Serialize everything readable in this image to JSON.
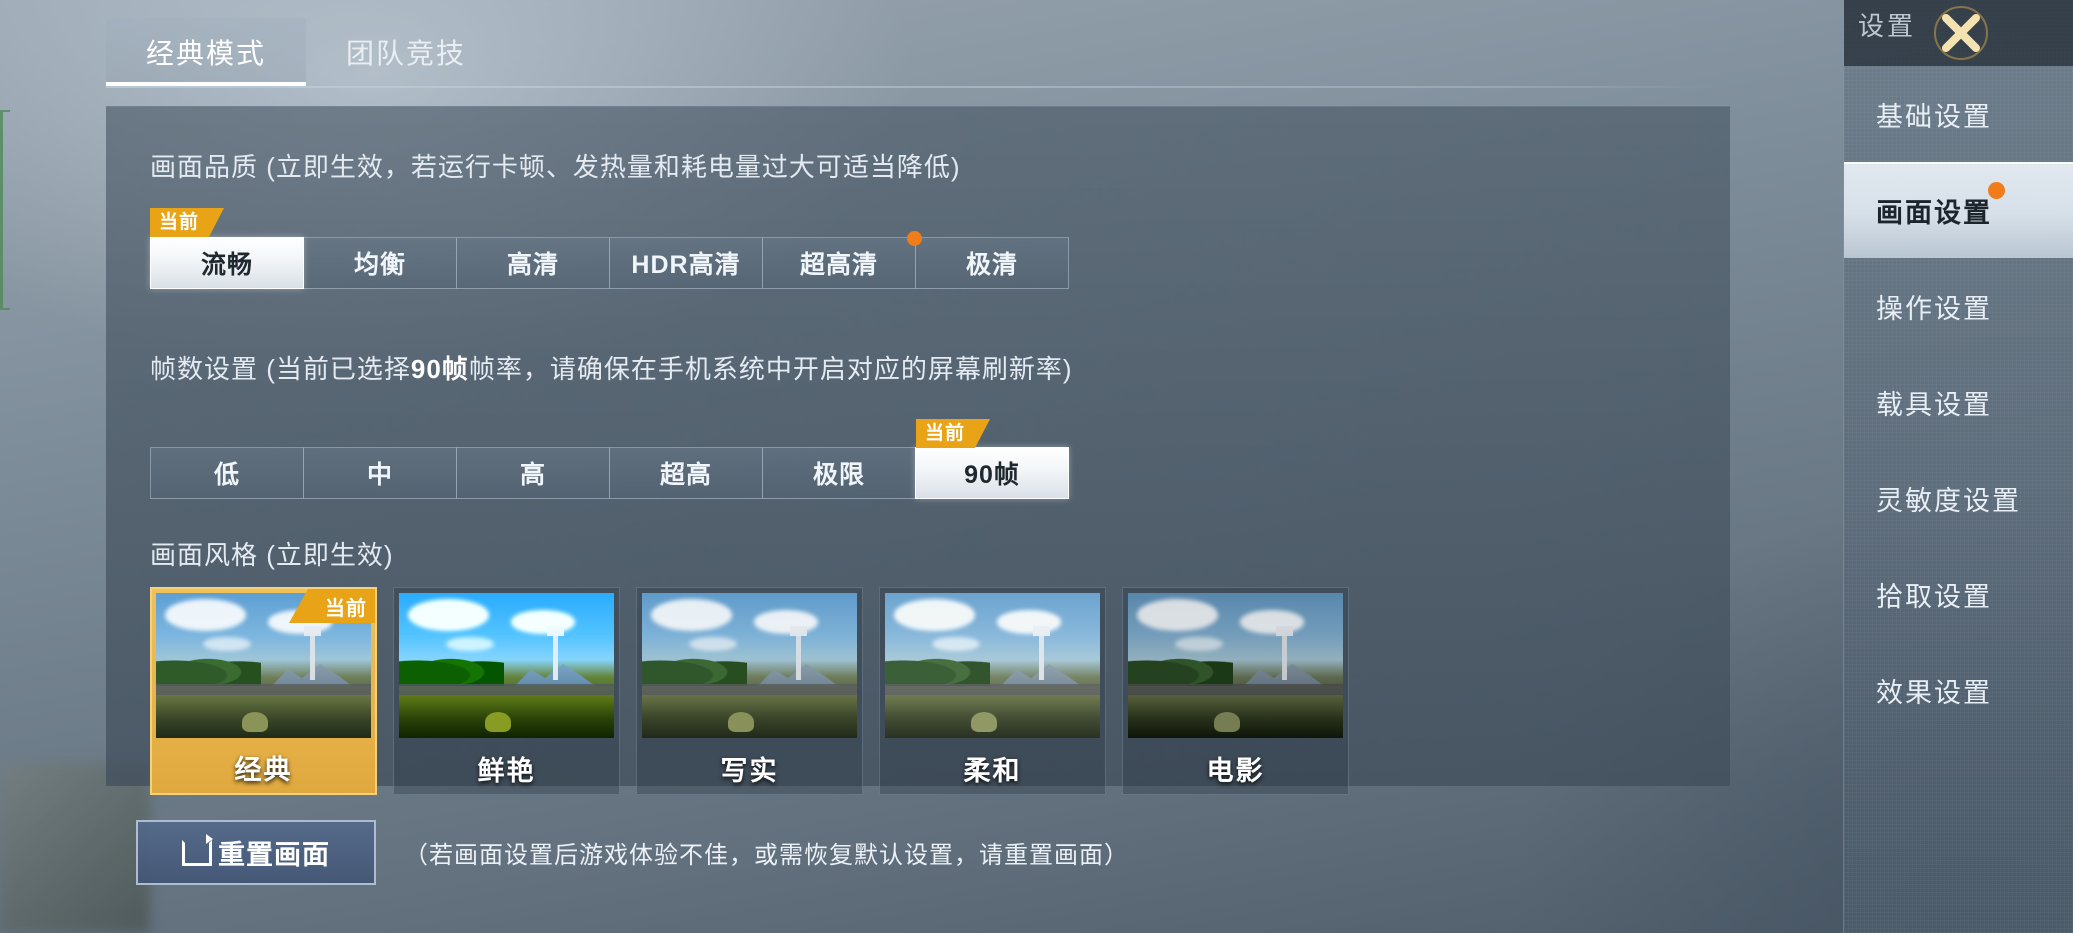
{
  "tabs": [
    {
      "label": "经典模式",
      "active": true
    },
    {
      "label": "团队竞技",
      "active": false
    }
  ],
  "quality": {
    "section_label": "画面品质 (立即生效，若运行卡顿、发热量和耗电量过大可适当降低)",
    "current_badge": "当前",
    "options": [
      {
        "label": "流畅",
        "selected": true,
        "new_dot": false
      },
      {
        "label": "均衡",
        "selected": false,
        "new_dot": false
      },
      {
        "label": "高清",
        "selected": false,
        "new_dot": false
      },
      {
        "label": "HDR高清",
        "selected": false,
        "new_dot": false
      },
      {
        "label": "超高清",
        "selected": false,
        "new_dot": true
      },
      {
        "label": "极清",
        "selected": false,
        "new_dot": false
      }
    ]
  },
  "framerate": {
    "section_label_pre": "帧数设置 (当前已选择",
    "section_label_bold": "90帧",
    "section_label_post": "帧率，请确保在手机系统中开启对应的屏幕刷新率)",
    "current_badge": "当前",
    "options": [
      {
        "label": "低",
        "selected": false
      },
      {
        "label": "中",
        "selected": false
      },
      {
        "label": "高",
        "selected": false
      },
      {
        "label": "超高",
        "selected": false
      },
      {
        "label": "极限",
        "selected": false
      },
      {
        "label": "90帧",
        "selected": true
      }
    ]
  },
  "style": {
    "section_label": "画面风格 (立即生效)",
    "current_badge": "当前",
    "options": [
      {
        "label": "经典",
        "selected": true,
        "grade": "classic"
      },
      {
        "label": "鲜艳",
        "selected": false,
        "grade": "vivid"
      },
      {
        "label": "写实",
        "selected": false,
        "grade": "real"
      },
      {
        "label": "柔和",
        "selected": false,
        "grade": "soft"
      },
      {
        "label": "电影",
        "selected": false,
        "grade": "cine"
      }
    ]
  },
  "reset": {
    "button_label": "重置画面",
    "hint": "（若画面设置后游戏体验不佳，或需恢复默认设置，请重置画面）"
  },
  "sidebar": {
    "title": "设置",
    "items": [
      {
        "label": "基础设置",
        "active": false,
        "dot": false
      },
      {
        "label": "画面设置",
        "active": true,
        "dot": true
      },
      {
        "label": "操作设置",
        "active": false,
        "dot": false
      },
      {
        "label": "载具设置",
        "active": false,
        "dot": false
      },
      {
        "label": "灵敏度设置",
        "active": false,
        "dot": false
      },
      {
        "label": "拾取设置",
        "active": false,
        "dot": false
      },
      {
        "label": "效果设置",
        "active": false,
        "dot": false
      }
    ]
  },
  "colors": {
    "accent_orange": "#e8a317",
    "new_dot": "#f07c1a",
    "selected_bg": "#ffffff",
    "panel_bg": "#4b5a68"
  }
}
